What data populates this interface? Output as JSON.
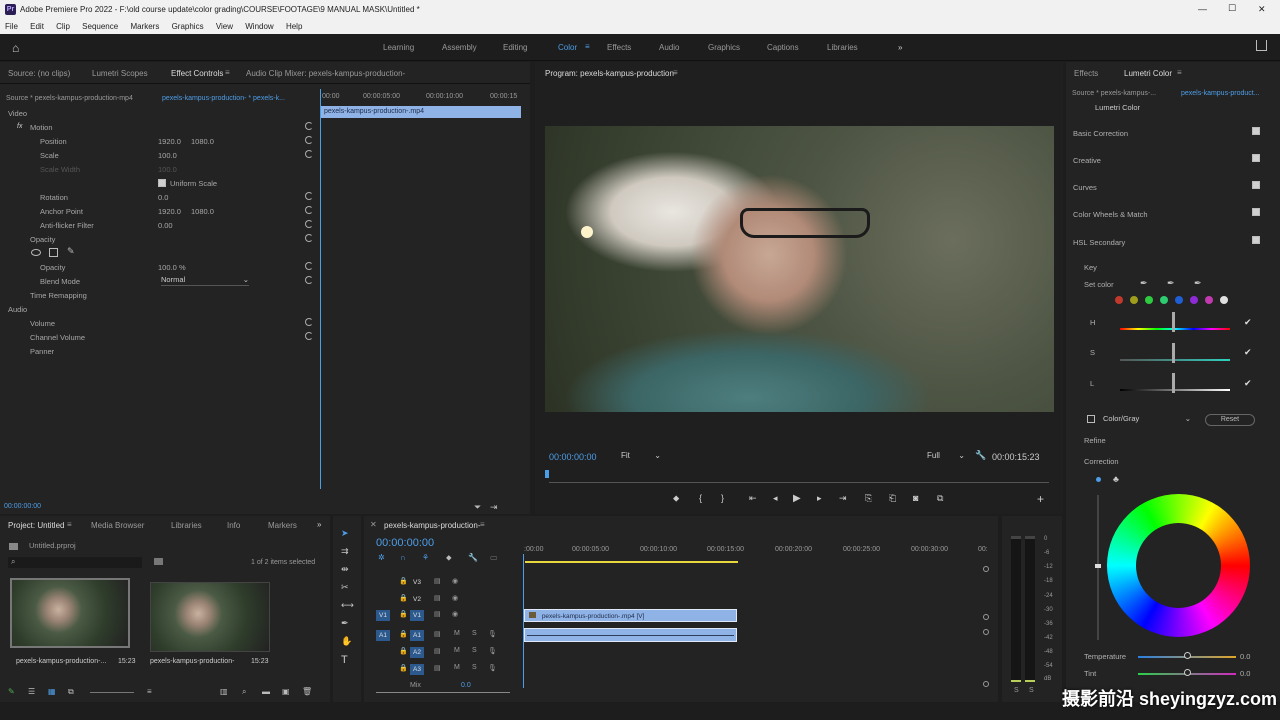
{
  "window": {
    "title": "Adobe Premiere Pro 2022 - F:\\old course update\\color grading\\COURSE\\FOOTAGE\\9 MANUAL MASK\\Untitled *",
    "minimize": "—",
    "maximize": "☐",
    "close": "✕"
  },
  "menu": [
    "File",
    "Edit",
    "Clip",
    "Sequence",
    "Markers",
    "Graphics",
    "View",
    "Window",
    "Help"
  ],
  "workspaces": [
    "Learning",
    "Assembly",
    "Editing",
    "Color",
    "Effects",
    "Audio",
    "Graphics",
    "Captions",
    "Libraries"
  ],
  "workspaces_more": "»",
  "source_panel": {
    "tabs": [
      "Source: (no clips)",
      "Lumetri Scopes",
      "Effect Controls",
      "Audio Clip Mixer: pexels-kampus-production-"
    ],
    "source_clip": "Source * pexels-kampus-production-mp4",
    "seq_clip": "pexels-kampus-production- * pexels-k...",
    "timecodes": [
      "00:00",
      "00:00:05:00",
      "00:00:10:00",
      "00:00:15"
    ],
    "clip_bar": "pexels-kampus-production-.mp4",
    "video_label": "Video",
    "audio_label": "Audio",
    "motion": "Motion",
    "position": {
      "label": "Position",
      "x": "1920.0",
      "y": "1080.0"
    },
    "scale": {
      "label": "Scale",
      "value": "100.0"
    },
    "scale_width": {
      "label": "Scale Width",
      "value": "100.0"
    },
    "uniform_scale": "Uniform Scale",
    "rotation": {
      "label": "Rotation",
      "value": "0.0"
    },
    "anchor": {
      "label": "Anchor Point",
      "x": "1920.0",
      "y": "1080.0"
    },
    "antiflicker": {
      "label": "Anti-flicker Filter",
      "value": "0.00"
    },
    "opacity_group": "Opacity",
    "opacity": {
      "label": "Opacity",
      "value": "100.0",
      "unit": "%"
    },
    "blend": {
      "label": "Blend Mode",
      "value": "Normal"
    },
    "time_remap": "Time Remapping",
    "volume": "Volume",
    "channel_volume": "Channel Volume",
    "panner": "Panner",
    "timecode_bottom": "00:00:00:00"
  },
  "program": {
    "title": "Program: pexels-kampus-production-",
    "timecode": "00:00:00:00",
    "fit": "Fit",
    "full": "Full",
    "duration": "00:00:15:23"
  },
  "lumetri": {
    "tabs": [
      "Effects",
      "Lumetri Color"
    ],
    "source": "Source * pexels-kampus-...",
    "seq": "pexels-kampus-product...",
    "effect": "Lumetri Color",
    "sections": [
      "Basic Correction",
      "Creative",
      "Curves",
      "Color Wheels & Match",
      "HSL Secondary"
    ],
    "key": "Key",
    "set_color": "Set color",
    "h": "H",
    "s": "S",
    "l": "L",
    "color_gray": "Color/Gray",
    "reset": "Reset",
    "refine": "Refine",
    "correction": "Correction",
    "temperature": {
      "label": "Temperature",
      "value": "0.0"
    },
    "tint": {
      "label": "Tint",
      "value": "0.0"
    },
    "swatches": [
      "#c0392b",
      "#9e9e1c",
      "#2ecc40",
      "#2ecc71",
      "#1f5fd6",
      "#8e2bd6",
      "#c33ab0",
      "#e0e0e0"
    ]
  },
  "project": {
    "tabs": [
      "Project: Untitled",
      "Media Browser",
      "Libraries",
      "Info",
      "Markers"
    ],
    "file": "Untitled.prproj",
    "count": "1 of 2 items selected",
    "items": [
      {
        "name": "pexels-kampus-production-...",
        "duration": "15:23"
      },
      {
        "name": "pexels-kampus-production-",
        "duration": "15:23"
      }
    ]
  },
  "timeline": {
    "tab": "pexels-kampus-production-",
    "timecode": "00:00:00:00",
    "ticks": [
      ":00:00",
      "00:00:05:00",
      "00:00:10:00",
      "00:00:15:00",
      "00:00:20:00",
      "00:00:25:00",
      "00:00:30:00",
      "00:"
    ],
    "tracks": [
      "V3",
      "V2",
      "V1",
      "A1",
      "A2",
      "A3"
    ],
    "source_v": "V1",
    "source_a": "A1",
    "mix": "Mix",
    "mix_value": "0.0",
    "clip_video": "pexels-kampus-production-.mp4 [V]",
    "meter_scale": [
      "0",
      "-6",
      "-12",
      "-18",
      "-24",
      "-30",
      "-36",
      "-42",
      "-48",
      "-54",
      "dB"
    ],
    "meter_solo": [
      "S",
      "S"
    ]
  },
  "watermark": "摄影前沿 sheyingzyz.com"
}
